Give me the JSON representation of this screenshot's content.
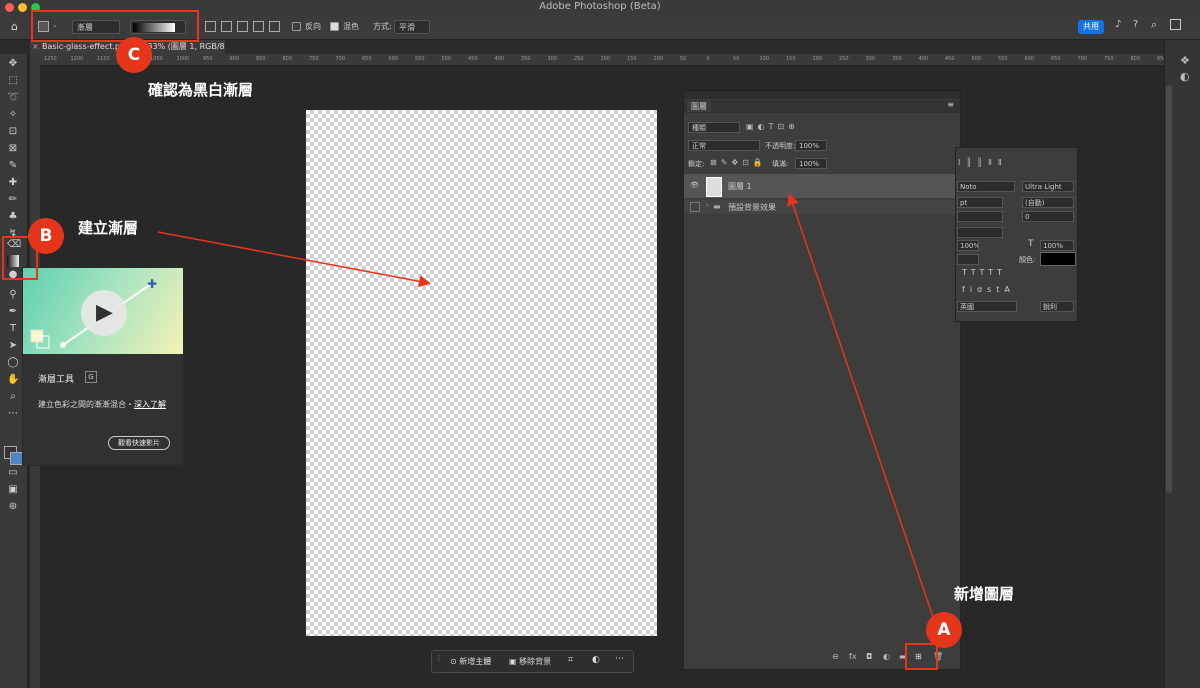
{
  "window": {
    "title": "Adobe Photoshop (Beta)"
  },
  "options_bar": {
    "mode_label": "漸層",
    "reverse_label": "反向",
    "dither_label": "混色",
    "method_label": "方式:",
    "method_value": "平滑"
  },
  "share_button": "共用",
  "document_tab": {
    "label": "Basic-glass-effect.psd @ 133% (圖層 1, RGB/8) *"
  },
  "ruler_ticks": [
    "1250",
    "1200",
    "1150",
    "1100",
    "1050",
    "1000",
    "950",
    "900",
    "850",
    "800",
    "750",
    "700",
    "650",
    "600",
    "550",
    "500",
    "450",
    "400",
    "350",
    "300",
    "250",
    "200",
    "150",
    "100",
    "50",
    "0",
    "50",
    "100",
    "150",
    "200",
    "250",
    "300",
    "350",
    "400",
    "450",
    "500",
    "550",
    "600",
    "650",
    "700",
    "750",
    "800",
    "850"
  ],
  "tooltip": {
    "title": "漸層工具",
    "shortcut": "G",
    "description": "建立色彩之間的漸漸混合・",
    "learn_more": "深入了解",
    "watch_button": "觀看快速影片"
  },
  "layers_panel": {
    "title": "圖層",
    "filter_value": "種類",
    "blend_mode": "正常",
    "opacity_label": "不透明度:",
    "opacity_value": "100%",
    "lock_label": "鎖定:",
    "fill_label": "填滿:",
    "fill_value": "100%",
    "layers": [
      {
        "name": "圖層 1",
        "selected": true
      },
      {
        "name": "預設背景效果",
        "selected": false
      }
    ]
  },
  "char_panel": {
    "font_family": "Noto",
    "font_style": "Ultra Light",
    "size": "pt",
    "leading": "(自動)",
    "kerning_value": "0",
    "vscale": "100%",
    "hscale": "100%",
    "color_label": "顏色:",
    "language": "英國",
    "aa": "銳利"
  },
  "taskbar": {
    "fill_label": "新增主體",
    "remove_bg_label": "移除背景"
  },
  "annotations": {
    "a_label": "A",
    "b_label": "B",
    "c_label": "C",
    "a_text": "新增圖層",
    "b_text": "建立漸層",
    "c_text": "確認為黑白漸層"
  },
  "colors": {
    "annotation_red": "#e5361c",
    "share_blue": "#1473e6"
  }
}
